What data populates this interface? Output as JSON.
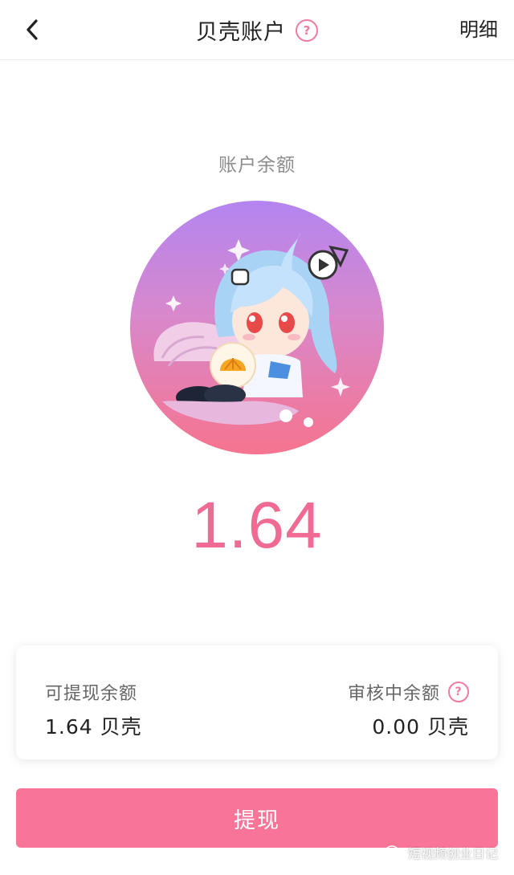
{
  "header": {
    "title": "贝壳账户",
    "help_icon": "?",
    "detail_link": "明细"
  },
  "balance": {
    "label": "账户余额",
    "value": "1.64"
  },
  "card": {
    "withdrawable_label": "可提现余额",
    "withdrawable_amount": "1.64 贝壳",
    "pending_label": "审核中余额",
    "pending_amount": "0.00 贝壳",
    "help_icon": "?"
  },
  "withdraw_button": {
    "label": "提现"
  },
  "watermark": {
    "text": "短视频创业日记"
  },
  "colors": {
    "accent": "#f87598",
    "balance_text": "#f06b94",
    "help_icon": "#f07aa0",
    "mascot_gradient_top": "#b385f0",
    "mascot_gradient_bottom": "#f6748e"
  },
  "icons": {
    "back": "chevron-left-icon",
    "help": "question-circle-icon",
    "watermark": "wechat-icon"
  }
}
